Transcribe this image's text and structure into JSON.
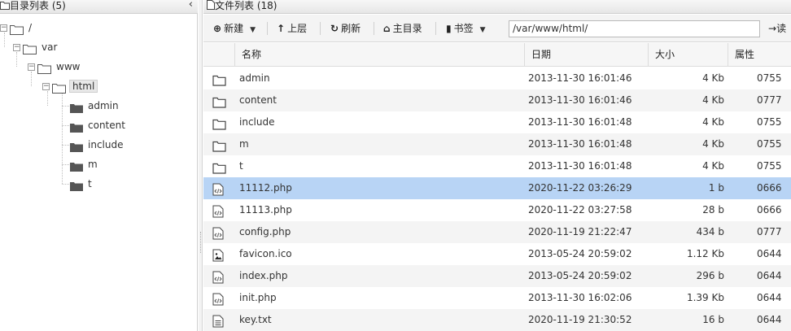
{
  "left_panel": {
    "title": "目录列表 (5)",
    "collapse_icon": "chevron-left-icon",
    "tree": [
      {
        "label": "/",
        "toggle": "−"
      },
      {
        "label": "var",
        "toggle": "−"
      },
      {
        "label": "www",
        "toggle": "−"
      },
      {
        "label": "html",
        "toggle": "−",
        "selected": true
      },
      {
        "label": "admin"
      },
      {
        "label": "content"
      },
      {
        "label": "include"
      },
      {
        "label": "m"
      },
      {
        "label": "t"
      }
    ]
  },
  "right_panel": {
    "title": "文件列表 (18)",
    "toolbar": {
      "new_label": "新建",
      "up_label": "上层",
      "refresh_label": "刷新",
      "home_label": "主目录",
      "bookmark_label": "书签",
      "path_value": "/var/www/html/",
      "go_label": "读"
    },
    "columns": {
      "name": "名称",
      "date": "日期",
      "size": "大小",
      "attr": "属性"
    },
    "files": [
      {
        "type": "folder",
        "name": "admin",
        "date": "2013-11-30 16:01:46",
        "size": "4 Kb",
        "attr": "0755"
      },
      {
        "type": "folder",
        "name": "content",
        "date": "2013-11-30 16:01:46",
        "size": "4 Kb",
        "attr": "0777"
      },
      {
        "type": "folder",
        "name": "include",
        "date": "2013-11-30 16:01:48",
        "size": "4 Kb",
        "attr": "0755"
      },
      {
        "type": "folder",
        "name": "m",
        "date": "2013-11-30 16:01:48",
        "size": "4 Kb",
        "attr": "0755"
      },
      {
        "type": "folder",
        "name": "t",
        "date": "2013-11-30 16:01:48",
        "size": "4 Kb",
        "attr": "0755"
      },
      {
        "type": "code",
        "name": "11112.php",
        "date": "2020-11-22 03:26:29",
        "size": "1 b",
        "attr": "0666",
        "selected": true
      },
      {
        "type": "code",
        "name": "11113.php",
        "date": "2020-11-22 03:27:58",
        "size": "28 b",
        "attr": "0666"
      },
      {
        "type": "code",
        "name": "config.php",
        "date": "2020-11-19 21:22:47",
        "size": "434 b",
        "attr": "0777"
      },
      {
        "type": "image",
        "name": "favicon.ico",
        "date": "2013-05-24 20:59:02",
        "size": "1.12 Kb",
        "attr": "0644"
      },
      {
        "type": "code",
        "name": "index.php",
        "date": "2013-05-24 20:59:02",
        "size": "296 b",
        "attr": "0644"
      },
      {
        "type": "code",
        "name": "init.php",
        "date": "2013-11-30 16:02:06",
        "size": "1.39 Kb",
        "attr": "0644"
      },
      {
        "type": "text",
        "name": "key.txt",
        "date": "2020-11-19 21:30:52",
        "size": "16 b",
        "attr": "0644"
      }
    ]
  }
}
